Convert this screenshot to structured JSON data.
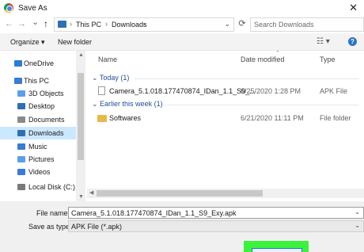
{
  "window": {
    "title": "Save As",
    "close_glyph": "✕"
  },
  "nav": {
    "back_glyph": "←",
    "forward_glyph": "→",
    "dropdown_glyph": "⌄",
    "up_glyph": "↑",
    "address": [
      "This PC",
      "Downloads"
    ],
    "address_sep": "›",
    "refresh_glyph": "⟳",
    "search_placeholder": "Search Downloads"
  },
  "toolbar": {
    "organize": "Organize ▾",
    "new_folder": "New folder",
    "view_glyph": "☷ ▾",
    "help_glyph": "?"
  },
  "sidebar": {
    "items": [
      {
        "label": "OneDrive",
        "icon": "cloud-icon",
        "color": "#2b7cd3"
      },
      {
        "label": "This PC",
        "icon": "computer-icon",
        "color": "#3a7bd5"
      },
      {
        "label": "3D Objects",
        "icon": "cube-icon",
        "color": "#5aa0e6"
      },
      {
        "label": "Desktop",
        "icon": "desktop-icon",
        "color": "#2f6fb5"
      },
      {
        "label": "Documents",
        "icon": "document-icon",
        "color": "#8a8a8a"
      },
      {
        "label": "Downloads",
        "icon": "download-icon",
        "color": "#2f6fb5",
        "selected": true
      },
      {
        "label": "Music",
        "icon": "music-icon",
        "color": "#3a7bd5"
      },
      {
        "label": "Pictures",
        "icon": "pictures-icon",
        "color": "#5aa0e6"
      },
      {
        "label": "Videos",
        "icon": "video-icon",
        "color": "#3a7bd5"
      },
      {
        "label": "Local Disk (C:)",
        "icon": "disk-icon",
        "color": "#7a7a7a"
      }
    ]
  },
  "columns": {
    "name": "Name",
    "date": "Date modified",
    "type": "Type",
    "sort_glyph": "⌃"
  },
  "groups": [
    {
      "label": "Today (1)",
      "rows": [
        {
          "name": "Camera_5.1.018.177470874_IDan_1.1_S9_...",
          "date": "6/25/2020 1:28 PM",
          "type": "APK File",
          "icon": "apk-file-icon"
        }
      ]
    },
    {
      "label": "Earlier this week (1)",
      "rows": [
        {
          "name": "Softwares",
          "date": "6/21/2020 11:11 PM",
          "type": "File folder",
          "icon": "folder-icon"
        }
      ]
    }
  ],
  "bottom": {
    "file_name_label": "File name:",
    "file_name_value": "Camera_5.1.018.177470874_IDan_1.1_S9_Exy.apk",
    "save_type_label": "Save as type:",
    "save_type_value": "APK File (*.apk)"
  },
  "accent": {
    "highlight": "#39f33c",
    "selection": "#cce8ff"
  }
}
